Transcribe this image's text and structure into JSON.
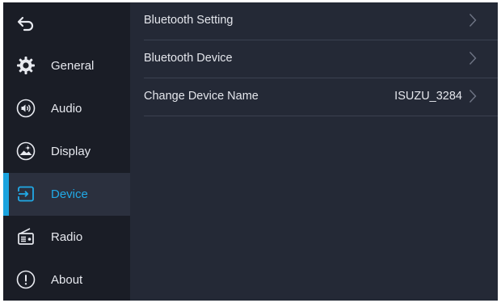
{
  "sidebar": {
    "back": {
      "icon": "back-arrow-icon"
    },
    "items": [
      {
        "label": "General",
        "icon": "gear-icon",
        "active": false
      },
      {
        "label": "Audio",
        "icon": "speaker-icon",
        "active": false
      },
      {
        "label": "Display",
        "icon": "display-icon",
        "active": false
      },
      {
        "label": "Device",
        "icon": "device-input-icon",
        "active": true
      },
      {
        "label": "Radio",
        "icon": "radio-icon",
        "active": false
      },
      {
        "label": "About",
        "icon": "info-exclamation-icon",
        "active": false
      }
    ]
  },
  "main": {
    "rows": [
      {
        "label": "Bluetooth Setting",
        "value": ""
      },
      {
        "label": "Bluetooth Device",
        "value": ""
      },
      {
        "label": "Change Device Name",
        "value": "ISUZU_3284"
      }
    ]
  },
  "colors": {
    "accent": "#1aa3df",
    "sidebar_bg": "#1a1d26",
    "content_bg": "#242936",
    "active_bg": "#2b303e"
  }
}
